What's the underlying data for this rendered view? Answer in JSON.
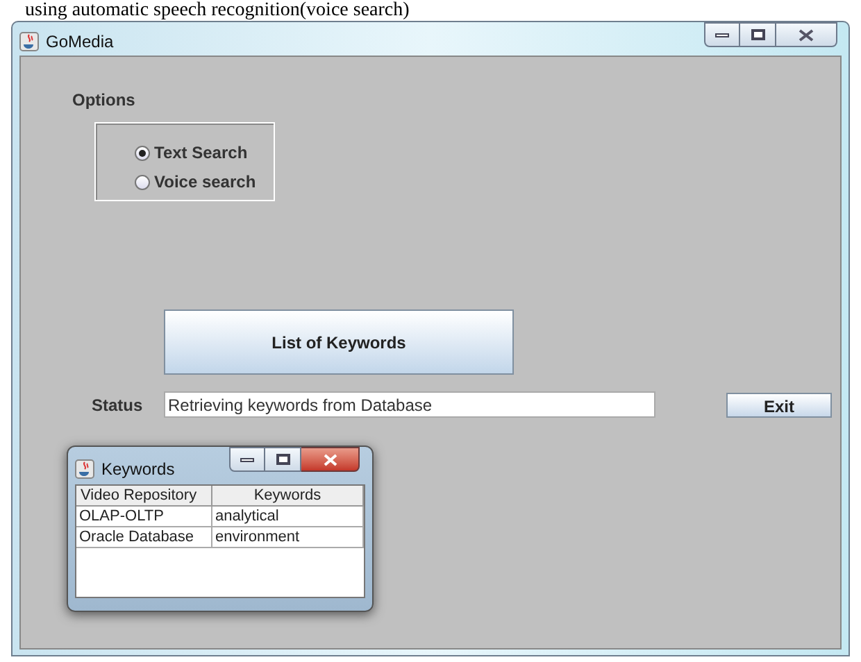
{
  "caption": "using automatic speech recognition(voice search)",
  "window": {
    "title": "GoMedia"
  },
  "options": {
    "label": "Options",
    "radios": [
      {
        "label": "Text Search",
        "selected": true
      },
      {
        "label": "Voice search",
        "selected": false
      }
    ]
  },
  "list_button": "List of Keywords",
  "status": {
    "label": "Status",
    "value": "Retrieving keywords from Database"
  },
  "exit_button": "Exit",
  "keywords_window": {
    "title": "Keywords",
    "table": {
      "columns": [
        "Video Repository",
        "Keywords"
      ],
      "rows": [
        [
          "OLAP-OLTP",
          "analytical"
        ],
        [
          "Oracle Database",
          "environment"
        ]
      ]
    }
  }
}
